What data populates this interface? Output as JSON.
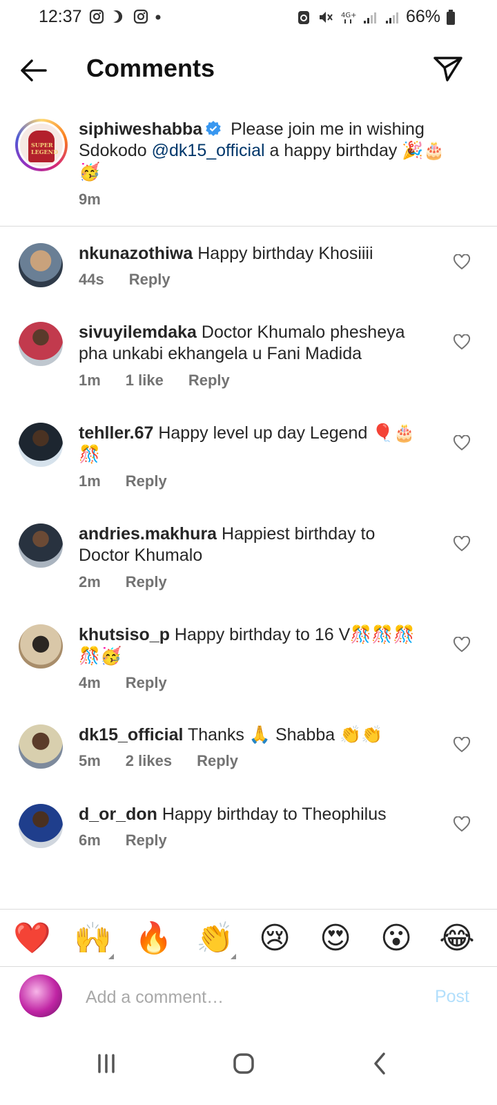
{
  "status_bar": {
    "time": "12:37",
    "battery": "66%"
  },
  "header": {
    "title": "Comments"
  },
  "caption": {
    "username": "siphiweshabba",
    "text_before": " Please join me in wishing Sdokodo ",
    "mention": "@dk15_official",
    "text_after": " a happy birthday 🎉🎂🥳",
    "time": "9m",
    "avatar_text": "SUPER LEGEND"
  },
  "comments": [
    {
      "username": "nkunazothiwa",
      "text": " Happy birthday Khosiiii",
      "time": "44s",
      "likes": "",
      "reply": "Reply"
    },
    {
      "username": "sivuyilemdaka",
      "text": " Doctor Khumalo phesheya pha unkabi ekhangela u Fani Madida",
      "time": "1m",
      "likes": "1 like",
      "reply": "Reply"
    },
    {
      "username": "tehller.67",
      "text": " Happy level up day Legend 🎈🎂🎊",
      "time": "1m",
      "likes": "",
      "reply": "Reply"
    },
    {
      "username": "andries.makhura",
      "text": " Happiest birthday to Doctor Khumalo",
      "time": "2m",
      "likes": "",
      "reply": "Reply"
    },
    {
      "username": "khutsiso_p",
      "text": " Happy birthday to 16 V🎊🎊🎊🎊🥳",
      "time": "4m",
      "likes": "",
      "reply": "Reply"
    },
    {
      "username": "dk15_official",
      "text": " Thanks 🙏 Shabba 👏👏",
      "time": "5m",
      "likes": "2 likes",
      "reply": "Reply"
    },
    {
      "username": "d_or_don",
      "text": " Happy birthday to Theophilus",
      "time": "6m",
      "likes": "",
      "reply": "Reply"
    }
  ],
  "emoji_bar": [
    "❤️",
    "🙌",
    "🔥",
    "👏",
    "😢",
    "😍",
    "😮",
    "😂"
  ],
  "composer": {
    "placeholder": "Add a comment…",
    "post_label": "Post"
  },
  "colors": {
    "link": "#00376b",
    "verified": "#3897f0",
    "post_disabled": "#b2dffc",
    "meta": "#737373"
  },
  "icons": {
    "back": "arrow-left-icon",
    "share": "paper-plane-icon",
    "heart": "heart-outline-icon",
    "verified": "verified-badge-icon"
  }
}
